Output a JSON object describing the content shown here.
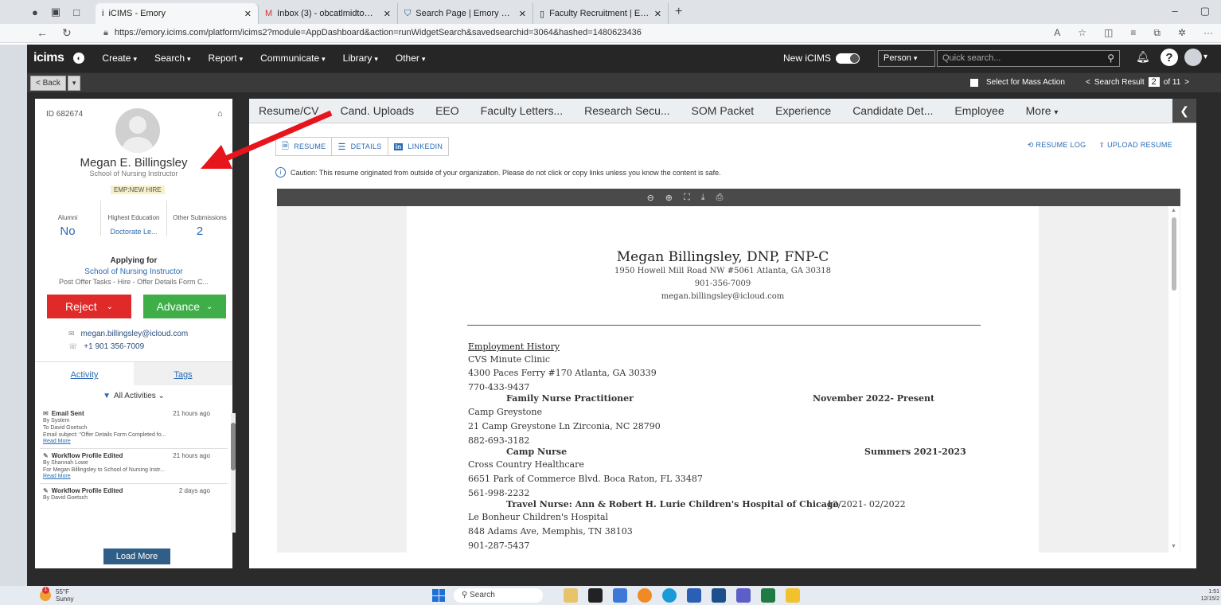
{
  "browser": {
    "tabs": [
      {
        "label": "iCIMS - Emory",
        "icon": "i"
      },
      {
        "label": "Inbox (3) - obcatlmidtown@gma",
        "icon": "M"
      },
      {
        "label": "Search Page | Emory University |",
        "icon": "shield"
      },
      {
        "label": "Faculty Recruitment | Emory Univ",
        "icon": "doc"
      }
    ],
    "url": "https://emory.icims.com/platform/icims2?module=AppDashboard&action=runWidgetSearch&savedsearchid=3064&hashed=1480623436"
  },
  "topnav": {
    "logo": "icims",
    "items": [
      "Create",
      "Search",
      "Report",
      "Communicate",
      "Library",
      "Other"
    ],
    "new_icims": "New iCIMS",
    "person_select": "Person",
    "quick_search_placeholder": "Quick search..."
  },
  "subbar": {
    "back": "Back",
    "mass_action": "Select for Mass Action",
    "search_result_label": "Search Result",
    "search_result_page": "2",
    "search_result_total": "of 11"
  },
  "profile": {
    "id": "ID 682674",
    "name": "Megan E. Billingsley",
    "title": "School of Nursing Instructor",
    "badge": "EMP:NEW HIRE",
    "stats": [
      {
        "label": "Alumni",
        "value": "No"
      },
      {
        "label": "Highest Education",
        "value": "Doctorate Le..."
      },
      {
        "label": "Other Submissions",
        "value": "2"
      }
    ],
    "applying_for": "Applying for",
    "job": "School of Nursing Instructor",
    "status": "Post Offer Tasks - Hire - Offer Details Form C...",
    "reject": "Reject",
    "advance": "Advance",
    "email": "megan.billingsley@icloud.com",
    "phone": "+1 901 356-7009",
    "tabs": [
      "Activity",
      "Tags"
    ],
    "activity_filter": "All Activities",
    "activities": [
      {
        "title": "Email Sent",
        "time": "21 hours ago",
        "lines": [
          "By System",
          "To David Goetsch",
          "Email subject: \"Offer Details Form Completed fo..."
        ],
        "more": "Read More",
        "icon": "envelope-icon"
      },
      {
        "title": "Workflow Profile Edited",
        "time": "21 hours ago",
        "lines": [
          "By Shannah Lowe",
          "For Megan Billingsley to School of Nursing Instr..."
        ],
        "more": "Read More",
        "icon": "edit-icon"
      },
      {
        "title": "Workflow Profile Edited",
        "time": "2 days ago",
        "lines": [
          "By David Goetsch"
        ],
        "more": "",
        "icon": "edit-icon"
      }
    ],
    "load_more": "Load More"
  },
  "content": {
    "tabs": [
      "Resume/CV",
      "Cand. Uploads",
      "EEO",
      "Faculty Letters...",
      "Research Secu...",
      "SOM Packet",
      "Experience",
      "Candidate Det...",
      "Employee",
      "More"
    ],
    "subtabs": [
      "RESUME",
      "DETAILS",
      "LINKEDIN"
    ],
    "resume_log": "RESUME LOG",
    "upload_resume": "UPLOAD RESUME",
    "caution": "Caution: This resume originated from outside of your organization. Please do not click or copy links unless you know the content is safe."
  },
  "resume": {
    "name": "Megan Billingsley, DNP, FNP-C",
    "address": "1950 Howell Mill Road NW #5061 Atlanta, GA 30318",
    "phone": "901-356-7009",
    "email": "megan.billingsley@icloud.com",
    "section": "Employment History",
    "entries": [
      {
        "employer": "CVS Minute Clinic",
        "address": "4300 Paces Ferry #170 Atlanta, GA 30339",
        "phone": "770-433-9437",
        "role": "Family Nurse Practitioner",
        "dates": "November 2022- Present"
      },
      {
        "employer": "Camp Greystone",
        "address": "21 Camp Greystone Ln Zirconia, NC 28790",
        "phone": "882-693-3182",
        "role": "Camp Nurse",
        "dates": "Summers 2021-2023"
      },
      {
        "employer": "Cross Country Healthcare",
        "address": "6651 Park of Commerce Blvd. Boca Raton, FL 33487",
        "phone": "561-998-2232",
        "role": "Travel Nurse: Ann & Robert H. Lurie Children's Hospital of Chicago",
        "dates": "12/2021- 02/2022"
      },
      {
        "employer": "Le Bonheur Children's Hospital",
        "address": "848 Adams Ave, Memphis, TN 38103",
        "phone": "901-287-5437",
        "role": "",
        "dates": ""
      }
    ]
  },
  "taskbar": {
    "temp": "55°F",
    "weather": "Sunny",
    "search": "Search",
    "time": "1:51",
    "date": "12/15/2"
  },
  "colors": {
    "reject": "#e02a2a",
    "advance": "#3fae49",
    "link": "#2a6bb3",
    "arrow": "#e8141b"
  }
}
